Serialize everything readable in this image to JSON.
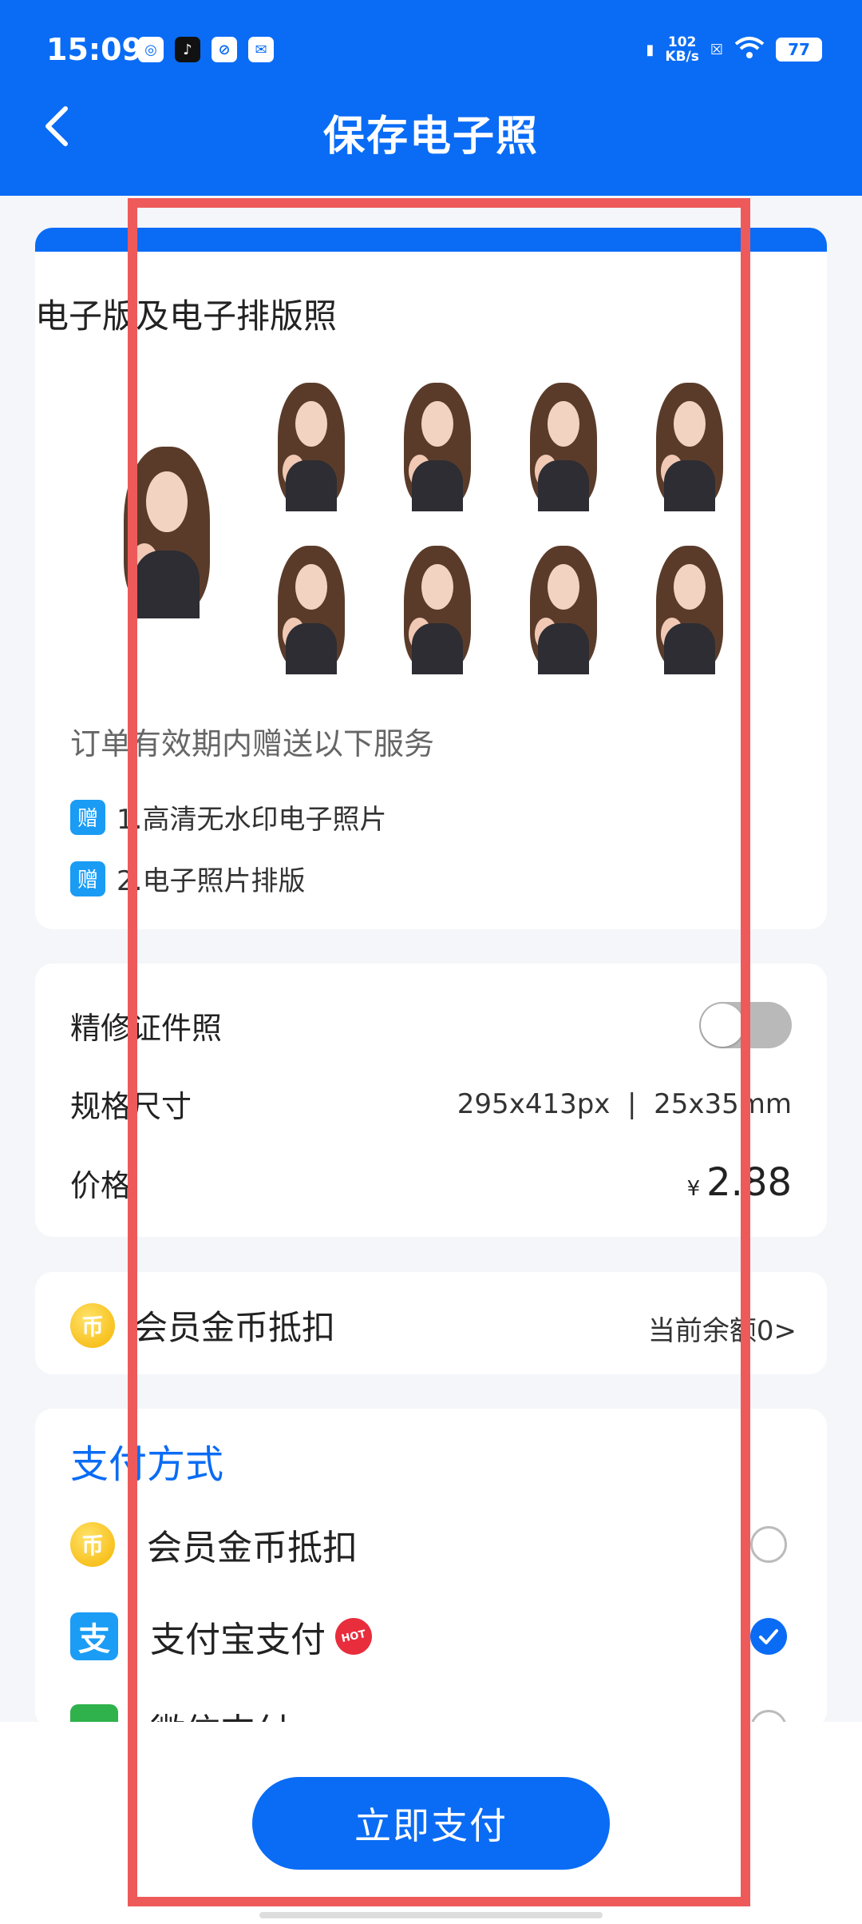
{
  "status_bar": {
    "time": "15:09",
    "app_icons": [
      "weibo-icon",
      "tiktok-icon",
      "link-icon",
      "mail-icon"
    ],
    "speed_value": "102",
    "speed_unit": "KB/s",
    "battery": "77"
  },
  "header": {
    "title": "保存电子照"
  },
  "photos": {
    "title": "电子版及电子排版照",
    "promo_title": "订单有效期内赠送以下服务",
    "gift_tag": "赠",
    "gifts": [
      "1.高清无水印电子照片",
      "2.电子照片排版"
    ]
  },
  "details": {
    "refine_label": "精修证件照",
    "refine_enabled": false,
    "spec_label": "规格尺寸",
    "spec_value": "295x413px  |  25x35mm",
    "price_label": "价格",
    "currency": "¥",
    "price_value": "2.88"
  },
  "coins": {
    "icon_text": "币",
    "label": "会员金币抵扣",
    "balance": "当前余额0>"
  },
  "payment": {
    "title": "支付方式",
    "methods": [
      {
        "icon": "coin-icon",
        "icon_text": "币",
        "label": "会员金币抵扣",
        "selected": false
      },
      {
        "icon": "alipay-icon",
        "icon_text": "支",
        "label": "支付宝支付",
        "badge": "HOT",
        "selected": true
      },
      {
        "icon": "wechat-pay-icon",
        "label": "微信支付",
        "selected": false
      }
    ]
  },
  "bottom": {
    "pay_button": "立即支付"
  },
  "colors": {
    "primary": "#0a6cf5",
    "highlight_frame": "#ee5a5a"
  }
}
